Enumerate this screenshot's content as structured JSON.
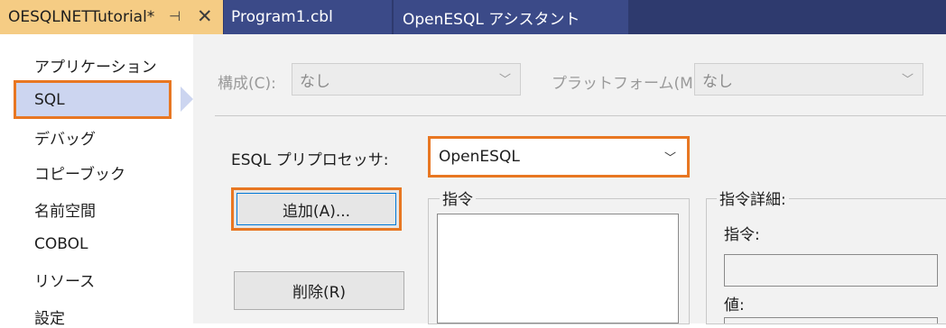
{
  "tabs": {
    "active": "OESQLNETTutorial*",
    "pin_glyph": "⊣",
    "close_glyph": "✕",
    "items": [
      "Program1.cbl",
      "OpenESQL アシスタント"
    ]
  },
  "nav": {
    "items": [
      "アプリケーション",
      "SQL",
      "デバッグ",
      "コピーブック",
      "名前空間",
      "COBOL",
      "リソース",
      "設定"
    ],
    "selected": "SQL"
  },
  "config": {
    "config_label": "構成(C):",
    "config_value": "なし",
    "platform_label": "プラットフォーム(M):",
    "platform_value": "なし"
  },
  "esql": {
    "label": "ESQL プリプロセッサ:",
    "value": "OpenESQL"
  },
  "buttons": {
    "add": "追加(A)...",
    "delete": "削除(R)"
  },
  "directives": {
    "group_title": "指令",
    "details_title": "指令詳細:",
    "directive_label": "指令:",
    "value_label": "値:"
  },
  "colors": {
    "highlight": "#e87722",
    "tab_active": "#f5cc84",
    "tab_bar": "#2e3a6e",
    "nav_selected": "#ccd5f0"
  }
}
